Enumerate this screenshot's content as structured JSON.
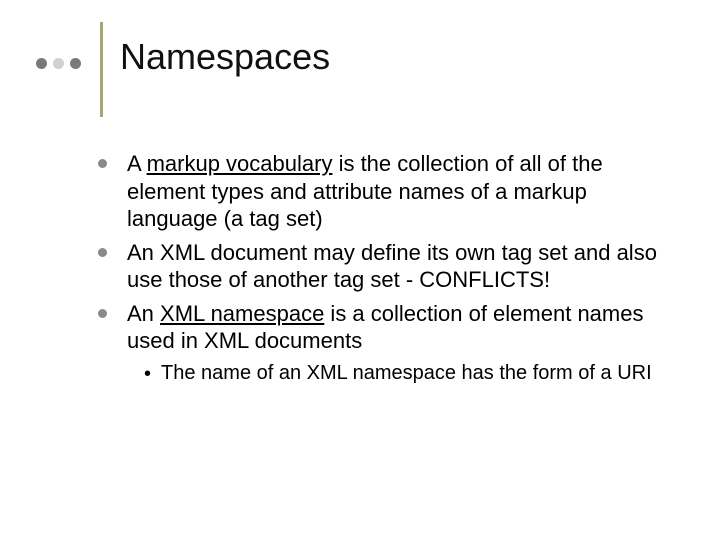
{
  "title": "Namespaces",
  "bullets": [
    {
      "pre": "A ",
      "u": "markup vocabulary",
      "post": " is the collection of all of the element types and attribute names of a markup language (a tag set)"
    },
    {
      "pre": "An XML document may define its own tag set and also use those of another tag set - CONFLICTS!",
      "u": "",
      "post": ""
    },
    {
      "pre": "An ",
      "u": "XML namespace",
      "post": " is a collection of element names used in XML documents"
    }
  ],
  "subbullet": "The name of an XML namespace has the form of a URI"
}
